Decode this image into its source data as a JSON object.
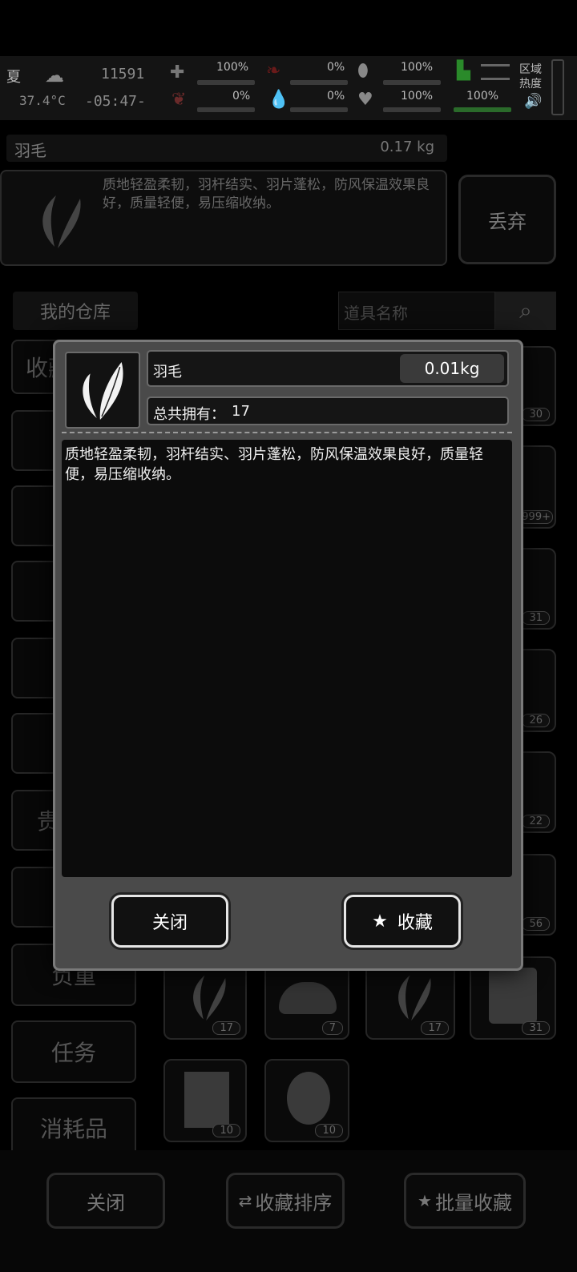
{
  "hud": {
    "season": "夏",
    "temperature": "37.4°C",
    "day_counter": "11591",
    "clock": "-05:47-",
    "health_pct": "100%",
    "hunger_pct": "0%",
    "stomach_pct": "100%",
    "bleed_pct": "0%",
    "thirst_pct": "0%",
    "mood_pct": "100%",
    "stamina_pct": "100%",
    "region_heat_label": "区域热度"
  },
  "item_header": {
    "name": "羽毛",
    "weight": "0.17 kg"
  },
  "item_info": {
    "description": "质地轻盈柔韧，羽杆结实、羽片蓬松，防风保温效果良好，质量轻便，易压缩收纳。",
    "discard_label": "丢弃"
  },
  "warehouse": {
    "title": "我的仓库",
    "search_placeholder": "道具名称"
  },
  "categories": [
    "收藏",
    "",
    "",
    "",
    "",
    "",
    "贵重",
    "",
    "负重",
    "任务",
    "消耗品"
  ],
  "slots_visible_badges": [
    "30",
    "999+",
    "31",
    "26",
    "22",
    "56",
    "17",
    "7",
    "17",
    "31",
    "10",
    "10"
  ],
  "bottom_bar": {
    "close_label": "关闭",
    "sort_label": "收藏排序",
    "batch_label": "批量收藏"
  },
  "modal": {
    "name": "羽毛",
    "weight": "0.01kg",
    "owned_label": "总共拥有：",
    "owned_count": "17",
    "description": "质地轻盈柔韧，羽杆结实、羽片蓬松，防风保温效果良好，质量轻便，易压缩收纳。",
    "close_label": "关闭",
    "favorite_label": "收藏"
  },
  "colors": {
    "modal_bg": "#4a4a4a",
    "modal_border": "#7a7a7a",
    "button_border": "#e6e6e6",
    "health_bar": "#3aa040"
  }
}
